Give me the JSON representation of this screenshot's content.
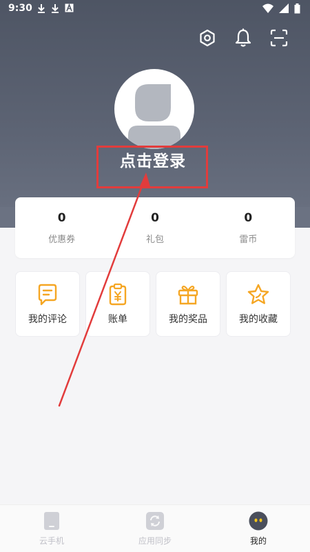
{
  "status_bar": {
    "time": "9:30",
    "left_icons": [
      "download-icon",
      "download-icon",
      "font-a-icon"
    ],
    "right_icons": [
      "wifi-icon",
      "signal-icon",
      "battery-icon"
    ]
  },
  "header": {
    "actions": [
      "settings-icon",
      "bell-icon",
      "scan-icon"
    ]
  },
  "profile": {
    "login_text": "点击登录"
  },
  "stats": [
    {
      "value": "0",
      "label": "优惠券"
    },
    {
      "value": "0",
      "label": "礼包"
    },
    {
      "value": "0",
      "label": "雷币"
    }
  ],
  "shortcuts": [
    {
      "label": "我的评论",
      "icon": "comment-icon"
    },
    {
      "label": "账单",
      "icon": "bill-icon"
    },
    {
      "label": "我的奖品",
      "icon": "gift-icon"
    },
    {
      "label": "我的收藏",
      "icon": "star-icon"
    }
  ],
  "bottom_nav": [
    {
      "label": "云手机",
      "icon": "phone-icon",
      "active": false
    },
    {
      "label": "应用同步",
      "icon": "sync-icon",
      "active": false
    },
    {
      "label": "我的",
      "icon": "profile-face-icon",
      "active": true
    }
  ],
  "colors": {
    "header_top": "#4e5564",
    "accent_orange": "#f5a623",
    "highlight_red": "#e23c3c",
    "page_bg": "#f5f5f7"
  }
}
